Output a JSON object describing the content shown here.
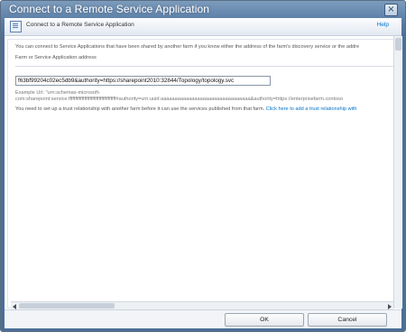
{
  "window": {
    "title": "Connect to a Remote Service Application",
    "close_glyph": "×"
  },
  "ribbon": {
    "icon": "dialog-icon",
    "title": "Connect to a Remote Service Application",
    "help_label": "Help"
  },
  "content": {
    "intro": "You can connect to Service Applications that have been shared by another farm if you know either the address of the farm's discovery service or the addre",
    "field_label": "Farm or Service Application address",
    "field_value": "f63bf99204c02ec5db9&authority=https://sharepoint2010:32844/Topology/topology.svc",
    "example_line1": "Example Url: \"urn:schemas-microsoft-",
    "example_line2": "com:sharepoint:service:ffffffffffffffffffffffffffffffffffff#authority=urn:uuid:aaaaaaaaaaaaaaaaaaaaaaaaaaaaaaaa&authority=https://enterprisefarm.contoso",
    "warning_text": "You need to set up a trust relationship with another farm before it can use the services published from that farm.",
    "trust_link": "Click here to add a trust relationship with"
  },
  "footer": {
    "ok_label": "OK",
    "cancel_label": "Cancel"
  }
}
